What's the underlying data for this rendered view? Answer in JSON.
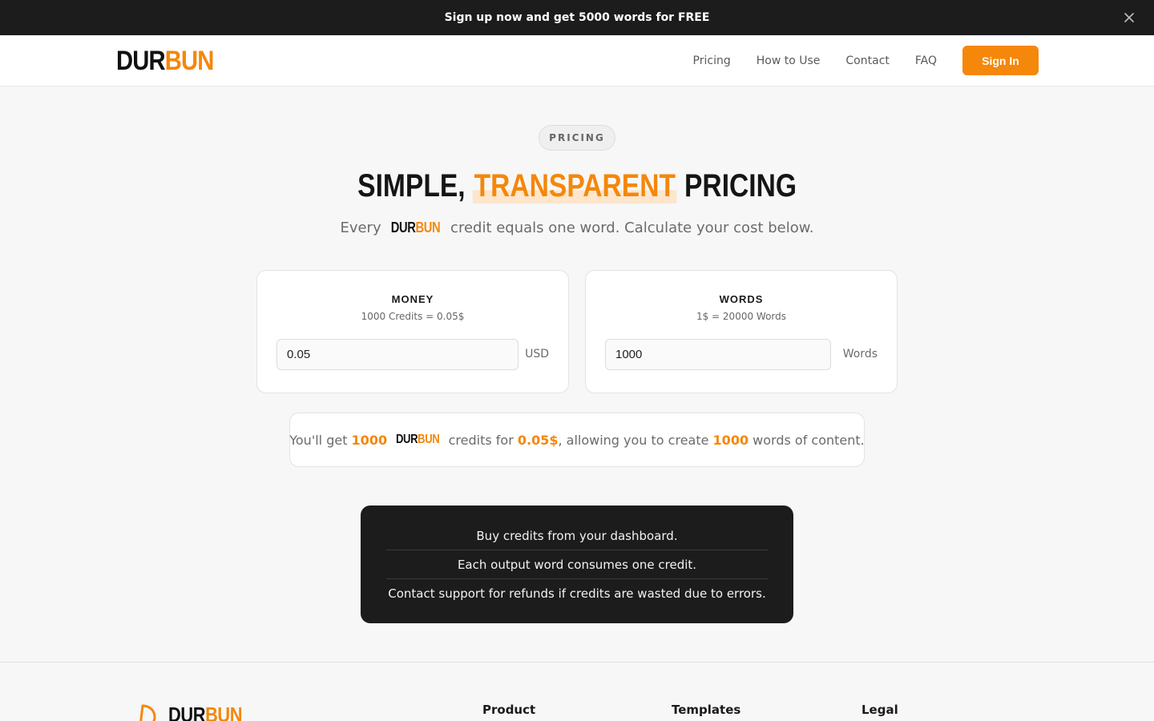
{
  "announcement": {
    "text": "Sign up now and get 5000 words for FREE",
    "close_icon": "close-icon"
  },
  "nav": {
    "logo_a": "DUR",
    "logo_b": "BUN",
    "links": [
      "Pricing",
      "How to Use",
      "Contact",
      "FAQ"
    ],
    "signin": "Sign In"
  },
  "hero": {
    "pill": "PRICING",
    "headline_pre": "SIMPLE, ",
    "headline_highlight": "TRANSPARENT",
    "headline_post": " PRICING",
    "sub_pre": "Every ",
    "sub_logo_a": "DUR",
    "sub_logo_b": "BUN",
    "sub_post": " credit equals one word. Calculate your cost below."
  },
  "calculator": {
    "money": {
      "title": "MONEY",
      "rate": "1000 Credits = 0.05$",
      "value": "0.05",
      "unit": "USD"
    },
    "words": {
      "title": "WORDS",
      "rate": "1$ = 20000 Words",
      "value": "1000",
      "unit": "Words"
    }
  },
  "result": {
    "pre": "You'll get ",
    "credits": "1000",
    "logo_a": "DUR",
    "logo_b": "BUN",
    "mid1": " credits for ",
    "price": "0.05$",
    "mid2": ", allowing you to create ",
    "words": "1000",
    "post": " words of content."
  },
  "info": [
    "Buy credits from your dashboard.",
    "Each output word consumes one credit.",
    "Contact support for refunds if credits are wasted due to errors."
  ],
  "footer": {
    "logo_a": "DUR",
    "logo_b": "BUN",
    "columns": [
      "Product",
      "Templates",
      "Legal"
    ]
  },
  "colors": {
    "brand_orange": "#f5870a",
    "dark": "#1c1c1c"
  }
}
